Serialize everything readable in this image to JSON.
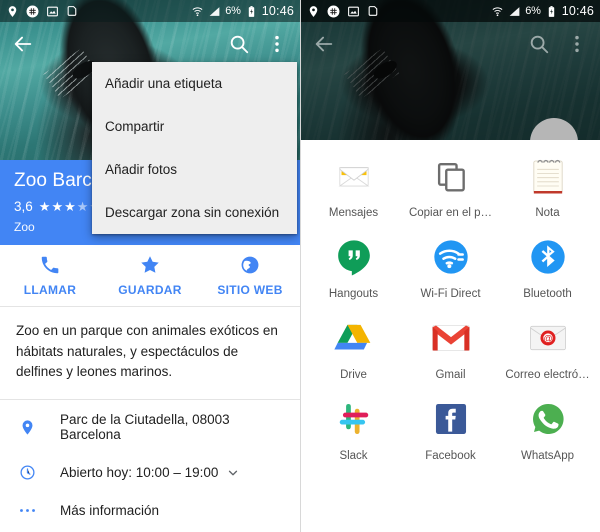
{
  "status_bar": {
    "left_icons": [
      "location-pin-icon",
      "slack-icon",
      "image-icon",
      "document-icon"
    ],
    "wifi_icon": "wifi-icon",
    "signal_icon": "signal-icon",
    "battery_percent": "6%",
    "battery_icon": "battery-charging-icon",
    "time": "10:46"
  },
  "left_panel": {
    "appbar": {
      "back_icon": "back-arrow-icon",
      "search_icon": "search-icon",
      "overflow_icon": "overflow-menu-icon"
    },
    "menu": {
      "items": [
        {
          "label": "Añadir una etiqueta"
        },
        {
          "label": "Compartir"
        },
        {
          "label": "Añadir fotos"
        },
        {
          "label": "Descargar zona sin conexión"
        }
      ]
    },
    "place_card": {
      "title": "Zoo Barcelona",
      "rating_value": "3,6",
      "stars_filled": 3,
      "stars_half": 1,
      "stars_total": 5,
      "category": "Zoo",
      "background_color": "#4285f4"
    },
    "actions": [
      {
        "label": "LLAMAR",
        "icon": "phone-icon"
      },
      {
        "label": "GUARDAR",
        "icon": "star-icon"
      },
      {
        "label": "SITIO WEB",
        "icon": "globe-icon"
      }
    ],
    "description": "Zoo en un parque con animales exóticos en hábitats naturales, y espectáculos de delfines y leones marinos.",
    "info_rows": [
      {
        "icon": "location-pin-icon",
        "text": "Parc de la Ciutadella, 08003 Barcelona",
        "chevron": false
      },
      {
        "icon": "clock-icon",
        "text": "Abierto hoy: 10:00 – 19:00",
        "chevron": true
      },
      {
        "icon": "more-dots-icon",
        "text": "Más información",
        "chevron": false
      }
    ]
  },
  "right_panel": {
    "appbar": {
      "back_icon": "back-arrow-icon",
      "search_icon": "search-icon",
      "overflow_icon": "overflow-menu-icon"
    },
    "fab": "floating-action-button",
    "share_sheet": {
      "apps": [
        {
          "label": "Mensajes",
          "icon": "messages-icon"
        },
        {
          "label": "Copiar en el p…",
          "icon": "copy-icon"
        },
        {
          "label": "Nota",
          "icon": "notes-icon"
        },
        {
          "label": "Hangouts",
          "icon": "hangouts-icon"
        },
        {
          "label": "Wi-Fi Direct",
          "icon": "wifi-direct-icon"
        },
        {
          "label": "Bluetooth",
          "icon": "bluetooth-icon"
        },
        {
          "label": "Drive",
          "icon": "google-drive-icon"
        },
        {
          "label": "Gmail",
          "icon": "gmail-icon"
        },
        {
          "label": "Correo electró…",
          "icon": "email-icon"
        },
        {
          "label": "Slack",
          "icon": "slack-icon"
        },
        {
          "label": "Facebook",
          "icon": "facebook-icon"
        },
        {
          "label": "WhatsApp",
          "icon": "whatsapp-icon"
        }
      ]
    }
  },
  "colors": {
    "accent_blue": "#4285f4",
    "menu_bg": "#eeeeee",
    "text_primary": "#212121"
  }
}
